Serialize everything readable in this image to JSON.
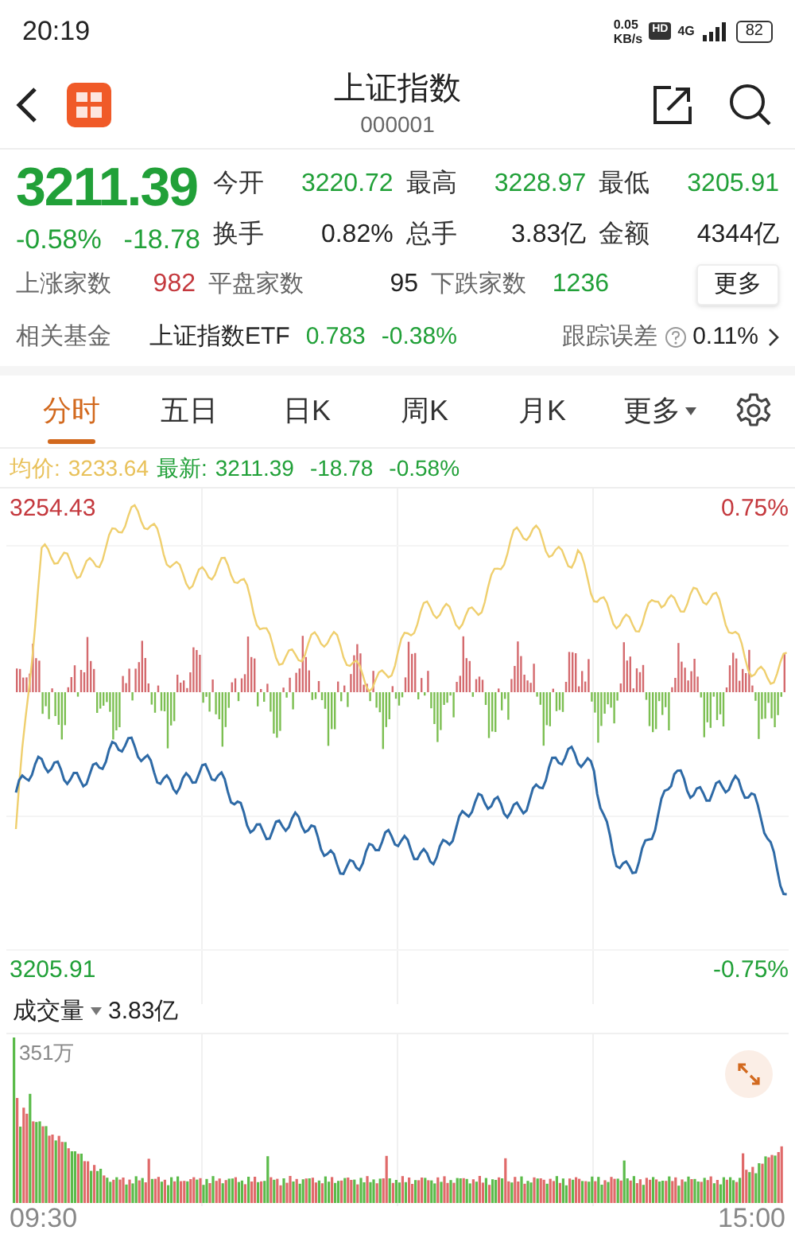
{
  "status_bar": {
    "time": "20:19",
    "speed_value": "0.05",
    "speed_unit": "KB/s",
    "hd": "HD",
    "network": "4G",
    "battery": "82"
  },
  "header": {
    "title": "上证指数",
    "code": "000001"
  },
  "quote": {
    "price": "3211.39",
    "change_pct": "-0.58%",
    "change": "-18.78",
    "stats": [
      {
        "label": "今开",
        "value": "3220.72",
        "color": "#21a038"
      },
      {
        "label": "最高",
        "value": "3228.97",
        "color": "#21a038"
      },
      {
        "label": "最低",
        "value": "3205.91",
        "color": "#21a038"
      },
      {
        "label": "换手",
        "value": "0.82%",
        "color": "#222222"
      },
      {
        "label": "总手",
        "value": "3.83亿",
        "color": "#222222"
      },
      {
        "label": "金额",
        "value": "4344亿",
        "color": "#222222"
      }
    ],
    "breadth": [
      {
        "label": "上涨家数",
        "value": "982",
        "color": "#c4383d"
      },
      {
        "label": "平盘家数",
        "value": "95",
        "color": "#222222"
      },
      {
        "label": "下跌家数",
        "value": "1236",
        "color": "#21a038"
      }
    ],
    "more_button": "更多"
  },
  "fund": {
    "label": "相关基金",
    "name": "上证指数ETF",
    "price": "0.783",
    "change": "-0.38%",
    "tracking_label": "跟踪误差",
    "tracking_value": "0.11%"
  },
  "tabs": [
    {
      "label": "分时",
      "selected": true
    },
    {
      "label": "五日",
      "selected": false
    },
    {
      "label": "日K",
      "selected": false
    },
    {
      "label": "周K",
      "selected": false
    },
    {
      "label": "月K",
      "selected": false
    },
    {
      "label": "更多",
      "selected": false,
      "dropdown": true
    }
  ],
  "legend": {
    "avg_label": "均价:",
    "avg_value": "3233.64",
    "latest_label": "最新:",
    "latest_value": "3211.39",
    "latest_change": "-18.78",
    "latest_pct": "-0.58%"
  },
  "chart": {
    "high": "3254.43",
    "high_pct": "0.75%",
    "low": "3205.91",
    "low_pct": "-0.75%"
  },
  "volume": {
    "label": "成交量",
    "total": "3.83亿",
    "max": "351万",
    "time_start": "09:30",
    "time_end": "15:00"
  }
}
